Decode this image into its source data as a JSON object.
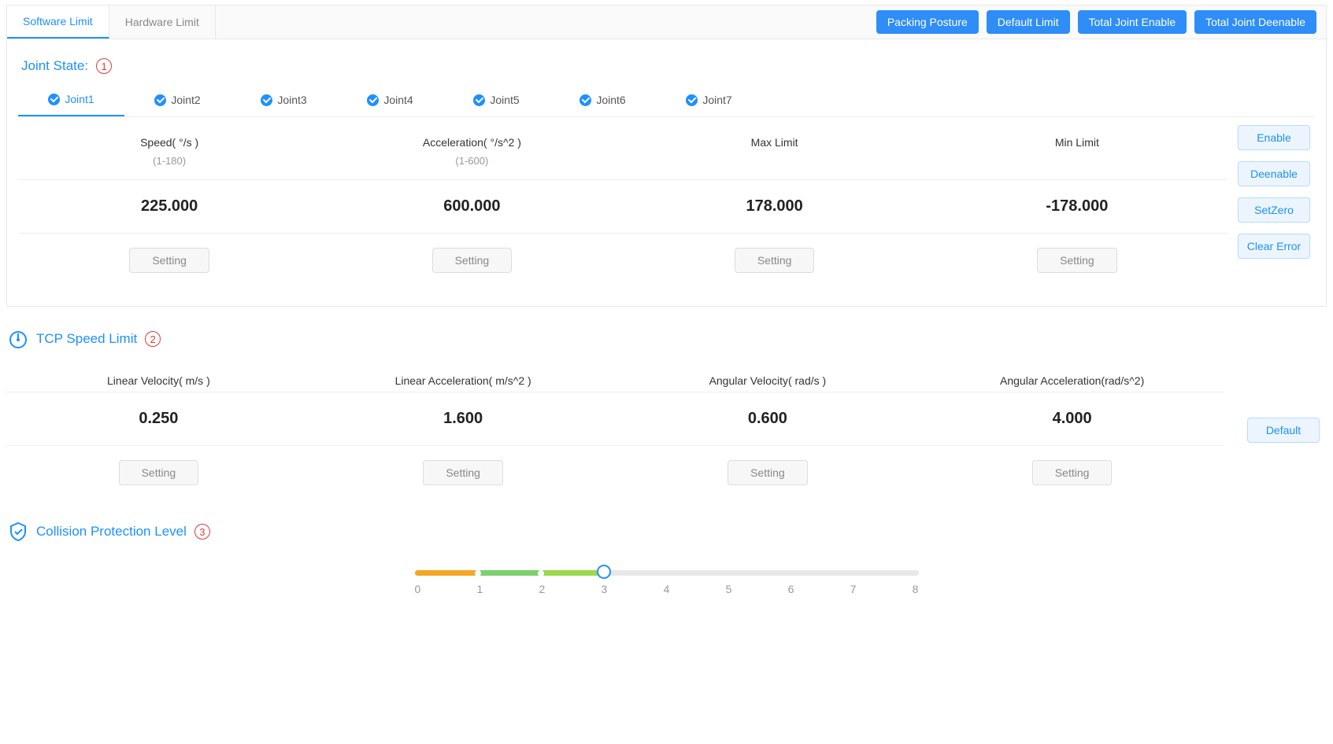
{
  "tabs": {
    "software": "Software Limit",
    "hardware": "Hardware Limit"
  },
  "top_buttons": {
    "packing": "Packing Posture",
    "default": "Default Limit",
    "enable_all": "Total Joint Enable",
    "disable_all": "Total Joint Deenable"
  },
  "joint_state": {
    "title": "Joint State:",
    "annotation": "1",
    "tabs": [
      "Joint1",
      "Joint2",
      "Joint3",
      "Joint4",
      "Joint5",
      "Joint6",
      "Joint7"
    ],
    "headers": {
      "speed": "Speed( °/s )",
      "accel": "Acceleration( °/s^2 )",
      "max": "Max Limit",
      "min": "Min Limit"
    },
    "ranges": {
      "speed": "(1-180)",
      "accel": "(1-600)"
    },
    "values": {
      "speed": "225.000",
      "accel": "600.000",
      "max": "178.000",
      "min": "-178.000"
    },
    "setting": "Setting",
    "side": {
      "enable": "Enable",
      "deenable": "Deenable",
      "setzero": "SetZero",
      "clear": "Clear Error"
    }
  },
  "tcp": {
    "title": "TCP Speed Limit",
    "annotation": "2",
    "headers": {
      "linvel": "Linear Velocity( m/s )",
      "linacc": "Linear Acceleration( m/s^2 )",
      "angvel": "Angular Velocity( rad/s )",
      "angacc": "Angular Acceleration(rad/s^2)"
    },
    "values": {
      "linvel": "0.250",
      "linacc": "1.600",
      "angvel": "0.600",
      "angacc": "4.000"
    },
    "setting": "Setting",
    "default": "Default"
  },
  "collision": {
    "title": "Collision Protection Level",
    "annotation": "3",
    "ticks": [
      "0",
      "1",
      "2",
      "3",
      "4",
      "5",
      "6",
      "7",
      "8"
    ],
    "value": 3,
    "max": 8
  }
}
